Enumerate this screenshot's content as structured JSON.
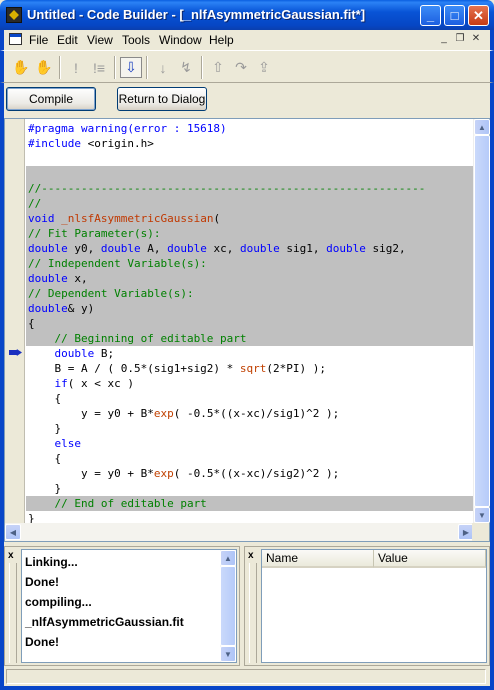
{
  "window": {
    "title": "Untitled - Code Builder - [_nlfAsymmetricGaussian.fit*]",
    "controls": {
      "minimize": "_",
      "maximize": "□",
      "close": "✕"
    }
  },
  "menu": {
    "items": [
      "File",
      "Edit",
      "View",
      "Tools",
      "Window",
      "Help"
    ],
    "mdi_controls": [
      "_",
      "❐",
      "✕"
    ]
  },
  "toolbar": {
    "icons": [
      "hand-icon",
      "hand-cross-icon",
      "exclamation-icon",
      "exclamation-list-icon",
      "step-into-icon",
      "step-over-icon",
      "step-down-icon",
      "cancel-step-icon",
      "step-out-icon",
      "run-icon",
      "run-to-cursor-icon"
    ]
  },
  "buttons": {
    "compile": "Compile",
    "return": "Return to Dialog"
  },
  "editor": {
    "lines": [
      {
        "segs": [
          [
            "pre",
            "#pragma warning(error : 15618)"
          ]
        ],
        "shaded": false
      },
      {
        "segs": [
          [
            "pre",
            "#include "
          ],
          [
            "txt",
            "<origin.h>"
          ]
        ],
        "shaded": false
      },
      {
        "segs": [
          [
            "txt",
            ""
          ]
        ],
        "shaded": false
      },
      {
        "segs": [
          [
            "txt",
            ""
          ]
        ],
        "shaded": true
      },
      {
        "segs": [
          [
            "com",
            "//----------------------------------------------------------"
          ]
        ],
        "shaded": true
      },
      {
        "segs": [
          [
            "com",
            "//"
          ]
        ],
        "shaded": true
      },
      {
        "segs": [
          [
            "kw",
            "void "
          ],
          [
            "dfn",
            "_nlsfAsymmetricGaussian"
          ],
          [
            "txt",
            "("
          ]
        ],
        "shaded": true
      },
      {
        "segs": [
          [
            "com",
            "// Fit Parameter(s):"
          ]
        ],
        "shaded": true
      },
      {
        "segs": [
          [
            "kw",
            "double"
          ],
          [
            "txt",
            " y0, "
          ],
          [
            "kw",
            "double"
          ],
          [
            "txt",
            " A, "
          ],
          [
            "kw",
            "double"
          ],
          [
            "txt",
            " xc, "
          ],
          [
            "kw",
            "double"
          ],
          [
            "txt",
            " sig1, "
          ],
          [
            "kw",
            "double"
          ],
          [
            "txt",
            " sig2,"
          ]
        ],
        "shaded": true
      },
      {
        "segs": [
          [
            "com",
            "// Independent Variable(s):"
          ]
        ],
        "shaded": true
      },
      {
        "segs": [
          [
            "kw",
            "double"
          ],
          [
            "txt",
            " x,"
          ]
        ],
        "shaded": true
      },
      {
        "segs": [
          [
            "com",
            "// Dependent Variable(s):"
          ]
        ],
        "shaded": true
      },
      {
        "segs": [
          [
            "kw",
            "double"
          ],
          [
            "txt",
            "& y)"
          ]
        ],
        "shaded": true
      },
      {
        "segs": [
          [
            "txt",
            "{"
          ]
        ],
        "shaded": true
      },
      {
        "segs": [
          [
            "com",
            "    // Beginning of editable part"
          ]
        ],
        "shaded": true
      },
      {
        "segs": [
          [
            "txt",
            "    "
          ],
          [
            "kw",
            "double"
          ],
          [
            "txt",
            " B;"
          ]
        ],
        "shaded": false
      },
      {
        "segs": [
          [
            "txt",
            "    B = A / ( 0.5*(sig1+sig2) * "
          ],
          [
            "fn",
            "sqrt"
          ],
          [
            "txt",
            "(2*PI) );"
          ]
        ],
        "shaded": false
      },
      {
        "segs": [
          [
            "txt",
            "    "
          ],
          [
            "kw",
            "if"
          ],
          [
            "txt",
            "( x < xc )"
          ]
        ],
        "shaded": false
      },
      {
        "segs": [
          [
            "txt",
            "    {"
          ]
        ],
        "shaded": false
      },
      {
        "segs": [
          [
            "txt",
            "        y = y0 + B*"
          ],
          [
            "fn",
            "exp"
          ],
          [
            "txt",
            "( -0.5*((x-xc)/sig1)^2 );"
          ]
        ],
        "shaded": false
      },
      {
        "segs": [
          [
            "txt",
            "    }"
          ]
        ],
        "shaded": false
      },
      {
        "segs": [
          [
            "txt",
            "    "
          ],
          [
            "kw",
            "else"
          ]
        ],
        "shaded": false
      },
      {
        "segs": [
          [
            "txt",
            "    {"
          ]
        ],
        "shaded": false
      },
      {
        "segs": [
          [
            "txt",
            "        y = y0 + B*"
          ],
          [
            "fn",
            "exp"
          ],
          [
            "txt",
            "( -0.5*((x-xc)/sig2)^2 );"
          ]
        ],
        "shaded": false
      },
      {
        "segs": [
          [
            "txt",
            "    }"
          ]
        ],
        "shaded": false
      },
      {
        "segs": [
          [
            "com",
            "    // End of editable part"
          ]
        ],
        "shaded": true
      },
      {
        "segs": [
          [
            "txt",
            "}"
          ]
        ],
        "shaded": false
      }
    ],
    "current_line_marker": "arrow-icon"
  },
  "output": {
    "lines": [
      "Linking...",
      "Done!",
      "compiling...",
      "_nlfAsymmetricGaussian.fit",
      "Done!"
    ],
    "close": "x"
  },
  "variables": {
    "columns": [
      "Name",
      "Value"
    ],
    "close": "x"
  }
}
